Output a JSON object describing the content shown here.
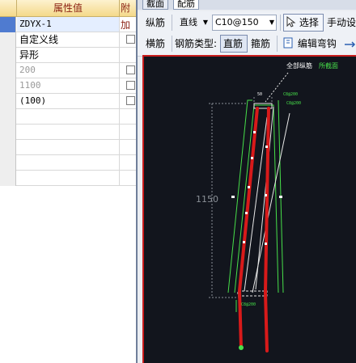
{
  "grid": {
    "header_value": "属性值",
    "header_extra": "附加",
    "rows": [
      {
        "value": "ZDYX-1",
        "mono": true,
        "gray": false,
        "checkbox": false,
        "selected": true
      },
      {
        "value": "自定义线",
        "mono": false,
        "gray": false,
        "checkbox": true,
        "selected": false
      },
      {
        "value": "异形",
        "mono": false,
        "gray": false,
        "checkbox": false,
        "selected": false
      },
      {
        "value": "200",
        "mono": true,
        "gray": true,
        "checkbox": true,
        "selected": false
      },
      {
        "value": "1100",
        "mono": true,
        "gray": true,
        "checkbox": true,
        "selected": false
      },
      {
        "value": "(100)",
        "mono": true,
        "gray": false,
        "checkbox": true,
        "selected": false
      },
      {
        "value": "",
        "mono": false,
        "gray": false,
        "checkbox": false,
        "selected": false
      },
      {
        "value": "",
        "mono": false,
        "gray": false,
        "checkbox": false,
        "selected": false
      },
      {
        "value": "",
        "mono": false,
        "gray": false,
        "checkbox": false,
        "selected": false
      },
      {
        "value": "",
        "mono": false,
        "gray": false,
        "checkbox": false,
        "selected": false
      },
      {
        "value": "",
        "mono": false,
        "gray": false,
        "checkbox": false,
        "selected": false
      }
    ]
  },
  "tabs": [
    "截面",
    "配筋"
  ],
  "toolbar1": {
    "label_longitudinal": "纵筋",
    "line_type": "直线",
    "rebar_spec": "C10@150",
    "select_btn": "选择",
    "manual_label": "手动设"
  },
  "toolbar2": {
    "label_transverse": "横筋",
    "rebar_type_label": "钢筋类型:",
    "straight_btn": "直筋",
    "stirrup_label": "箍筋",
    "edit_hook_btn": "编辑弯钩"
  },
  "canvas": {
    "dimension_label": "1150",
    "annot_all": "全部纵筋",
    "annot_section": "所截面",
    "annot_small1": "C8@200",
    "annot_small2": "C8@200",
    "annot_top": "50",
    "annot_bottom": "C8@200"
  },
  "colors": {
    "canvas_bg": "#12151d",
    "rebar_red": "#d81a1a",
    "outline_green": "#47e04a",
    "dim_gray": "#8a8f96",
    "text_white": "#ffffff"
  }
}
